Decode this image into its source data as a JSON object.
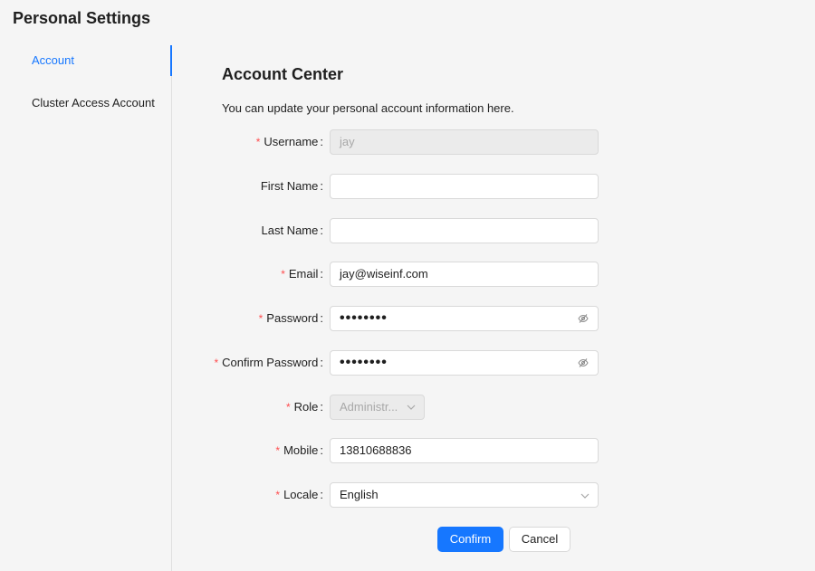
{
  "header": {
    "title": "Personal Settings"
  },
  "sidebar": {
    "items": [
      {
        "label": "Account",
        "active": true
      },
      {
        "label": "Cluster Access Account",
        "active": false
      }
    ]
  },
  "main": {
    "title": "Account Center",
    "description": "You can update your personal account information here.",
    "form": {
      "username": {
        "label": "Username",
        "required": true,
        "value": "jay",
        "disabled": true
      },
      "first_name": {
        "label": "First Name",
        "required": false,
        "value": ""
      },
      "last_name": {
        "label": "Last Name",
        "required": false,
        "value": ""
      },
      "email": {
        "label": "Email",
        "required": true,
        "value": "jay@wiseinf.com"
      },
      "password": {
        "label": "Password",
        "required": true,
        "masked_value": "••••••••",
        "icon": "eye-invisible-icon"
      },
      "confirm_password": {
        "label": "Confirm Password",
        "required": true,
        "masked_value": "••••••••",
        "icon": "eye-invisible-icon"
      },
      "role": {
        "label": "Role",
        "required": true,
        "value": "Administr...",
        "disabled": true
      },
      "mobile": {
        "label": "Mobile",
        "required": true,
        "value": "13810688836"
      },
      "locale": {
        "label": "Locale",
        "required": true,
        "value": "English"
      }
    },
    "actions": {
      "confirm_label": "Confirm",
      "cancel_label": "Cancel"
    }
  },
  "colors": {
    "accent": "#1677ff",
    "required_mark": "#ff4d4f",
    "background": "#f5f5f5"
  }
}
